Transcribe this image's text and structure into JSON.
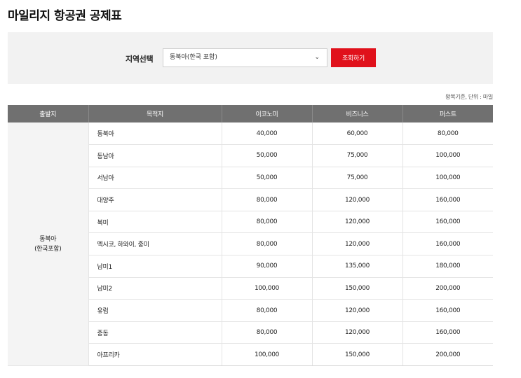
{
  "page": {
    "title": "마일리지 항공권 공제표"
  },
  "search": {
    "label": "지역선택",
    "selected_region": "동북아(한국 포함)",
    "chevron_icon": "chevron-down-icon",
    "button_label": "조회하기",
    "button_color": "#e0111b"
  },
  "table": {
    "note": "왕복기준, 단위 : 마일",
    "headers": [
      "출발지",
      "목적지",
      "이코노미",
      "비즈니스",
      "퍼스트"
    ],
    "origin_line1": "동북아",
    "origin_line2": "(한국포함)",
    "rows": [
      {
        "dest": "동북아",
        "economy": "40,000",
        "business": "60,000",
        "first": "80,000"
      },
      {
        "dest": "동남아",
        "economy": "50,000",
        "business": "75,000",
        "first": "100,000"
      },
      {
        "dest": "서남아",
        "economy": "50,000",
        "business": "75,000",
        "first": "100,000"
      },
      {
        "dest": "대양주",
        "economy": "80,000",
        "business": "120,000",
        "first": "160,000"
      },
      {
        "dest": "북미",
        "economy": "80,000",
        "business": "120,000",
        "first": "160,000"
      },
      {
        "dest": "멕시코, 하와이, 중미",
        "economy": "80,000",
        "business": "120,000",
        "first": "160,000"
      },
      {
        "dest": "남미1",
        "economy": "90,000",
        "business": "135,000",
        "first": "180,000"
      },
      {
        "dest": "남미2",
        "economy": "100,000",
        "business": "150,000",
        "first": "200,000"
      },
      {
        "dest": "유럽",
        "economy": "80,000",
        "business": "120,000",
        "first": "160,000"
      },
      {
        "dest": "중동",
        "economy": "80,000",
        "business": "120,000",
        "first": "160,000"
      },
      {
        "dest": "아프리카",
        "economy": "100,000",
        "business": "150,000",
        "first": "200,000"
      }
    ]
  }
}
